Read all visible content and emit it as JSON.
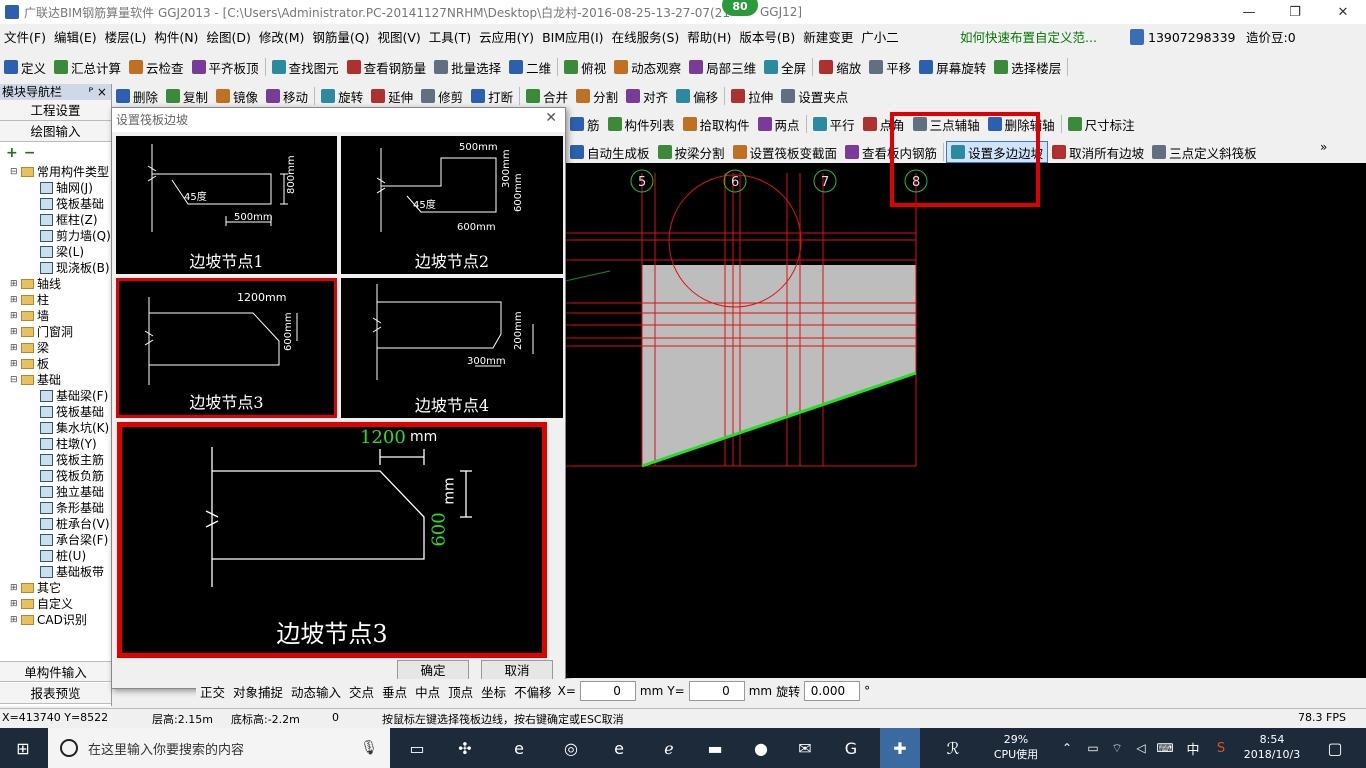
{
  "window": {
    "title": "广联达BIM钢筋算量软件 GGJ2013 - [C:\\Users\\Administrator.PC-20141127NRHM\\Desktop\\白龙村-2016-08-25-13-27-07(21",
    "title_suffix": "GGJ12]",
    "badge": "80",
    "min": "—",
    "restore": "❐",
    "close": "✕"
  },
  "menu": [
    "文件(F)",
    "编辑(E)",
    "楼层(L)",
    "构件(N)",
    "绘图(D)",
    "修改(M)",
    "钢筋量(Q)",
    "视图(V)",
    "工具(T)",
    "云应用(Y)",
    "BIM应用(I)",
    "在线服务(S)",
    "帮助(H)",
    "版本号(B)",
    "新建变更",
    "广小二"
  ],
  "menu_right": {
    "promo": "如何快速布置自定义范...",
    "phone": "13907298339",
    "beans": "造价豆:0"
  },
  "toolbar1": [
    "定义",
    "汇总计算",
    "云检查",
    "平齐板顶",
    "查找图元",
    "查看钢筋量",
    "批量选择",
    "二维",
    "俯视",
    "动态观察",
    "局部三维",
    "全屏",
    "缩放",
    "平移",
    "屏幕旋转",
    "选择楼层"
  ],
  "toolbar2": [
    "删除",
    "复制",
    "镜像",
    "移动",
    "旋转",
    "延伸",
    "修剪",
    "打断",
    "合并",
    "分割",
    "对齐",
    "偏移",
    "拉伸",
    "设置夹点"
  ],
  "toolbar3": [
    "筋",
    "构件列表",
    "拾取构件",
    "两点",
    "平行",
    "点角",
    "三点辅轴",
    "删除辅轴",
    "尺寸标注"
  ],
  "toolbar4": [
    "自动生成板",
    "按梁分割",
    "设置筏板变截面",
    "查看板内钢筋",
    "设置多边边坡",
    "取消所有边坡",
    "三点定义斜筏板"
  ],
  "nav": {
    "header": "模块导航栏",
    "pin": "ᴾ ×",
    "btn1": "工程设置",
    "btn2": "绘图输入",
    "bottom1": "单构件输入",
    "bottom2": "报表预览",
    "tree": [
      {
        "t": "常用构件类型",
        "lv": 0,
        "type": "fold",
        "exp": "⊟"
      },
      {
        "t": "轴网(J)",
        "lv": 1,
        "type": "leaf"
      },
      {
        "t": "筏板基础",
        "lv": 1,
        "type": "leaf"
      },
      {
        "t": "框柱(Z)",
        "lv": 1,
        "type": "leaf"
      },
      {
        "t": "剪力墙(Q)",
        "lv": 1,
        "type": "leaf"
      },
      {
        "t": "梁(L)",
        "lv": 1,
        "type": "leaf"
      },
      {
        "t": "现浇板(B)",
        "lv": 1,
        "type": "leaf"
      },
      {
        "t": "轴线",
        "lv": 0,
        "type": "fold",
        "exp": "⊞"
      },
      {
        "t": "柱",
        "lv": 0,
        "type": "fold",
        "exp": "⊞"
      },
      {
        "t": "墙",
        "lv": 0,
        "type": "fold",
        "exp": "⊞"
      },
      {
        "t": "门窗洞",
        "lv": 0,
        "type": "fold",
        "exp": "⊞"
      },
      {
        "t": "梁",
        "lv": 0,
        "type": "fold",
        "exp": "⊞"
      },
      {
        "t": "板",
        "lv": 0,
        "type": "fold",
        "exp": "⊞"
      },
      {
        "t": "基础",
        "lv": 0,
        "type": "fold",
        "exp": "⊟"
      },
      {
        "t": "基础梁(F)",
        "lv": 1,
        "type": "leaf"
      },
      {
        "t": "筏板基础",
        "lv": 1,
        "type": "leaf"
      },
      {
        "t": "集水坑(K)",
        "lv": 1,
        "type": "leaf"
      },
      {
        "t": "柱墩(Y)",
        "lv": 1,
        "type": "leaf"
      },
      {
        "t": "筏板主筋",
        "lv": 1,
        "type": "leaf"
      },
      {
        "t": "筏板负筋",
        "lv": 1,
        "type": "leaf"
      },
      {
        "t": "独立基础",
        "lv": 1,
        "type": "leaf"
      },
      {
        "t": "条形基础",
        "lv": 1,
        "type": "leaf"
      },
      {
        "t": "桩承台(V)",
        "lv": 1,
        "type": "leaf"
      },
      {
        "t": "承台梁(F)",
        "lv": 1,
        "type": "leaf"
      },
      {
        "t": "桩(U)",
        "lv": 1,
        "type": "leaf"
      },
      {
        "t": "基础板带",
        "lv": 1,
        "type": "leaf"
      },
      {
        "t": "其它",
        "lv": 0,
        "type": "fold",
        "exp": "⊞"
      },
      {
        "t": "自定义",
        "lv": 0,
        "type": "fold",
        "exp": "⊞"
      },
      {
        "t": "CAD识别",
        "lv": 0,
        "type": "fold",
        "exp": "⊞"
      }
    ]
  },
  "dialog": {
    "title": "设置筏板边坡",
    "close": "✕",
    "ok": "确定",
    "cancel": "取消",
    "nodes": [
      {
        "cap": "边坡节点1",
        "a": "45度",
        "b": "500mm",
        "c": "800mm"
      },
      {
        "cap": "边坡节点2",
        "a": "500mm",
        "b": "300mm",
        "c": "600mm",
        "d": "45度",
        "e": "600mm"
      },
      {
        "cap": "边坡节点3",
        "a": "1200mm",
        "b": "600mm"
      },
      {
        "cap": "边坡节点4",
        "a": "200mm",
        "b": "300mm"
      }
    ],
    "preview": {
      "cap": "边坡节点3",
      "a": "1200",
      "unit": "mm",
      "b": "600",
      "unit2": "mm"
    }
  },
  "axes": [
    "5",
    "6",
    "7",
    "8"
  ],
  "bottombar": {
    "items": [
      "正交",
      "对象捕捉",
      "动态输入",
      "交点",
      "垂点",
      "中点",
      "顶点",
      "坐标",
      "不偏移"
    ],
    "x_label": "X=",
    "x": "0",
    "mm": "mm",
    "y_label": "Y=",
    "y": "0",
    "mm2": "mm",
    "rotate": "旋转",
    "rot": "0.000",
    "deg": "°"
  },
  "status": {
    "coords": "X=413740 Y=8522",
    "floor_h": "层高:2.15m",
    "base_h": "底标高:-2.2m",
    "zero": "0",
    "hint": "按鼠标左键选择筏板边线，按右键确定或ESC取消",
    "fps": "78.3 FPS"
  },
  "taskbar": {
    "search": "在这里输入你要搜索的内容",
    "cpu": "29%",
    "cpu_label": "CPU使用",
    "lang": "中",
    "time": "8:54",
    "date": "2018/10/3"
  }
}
